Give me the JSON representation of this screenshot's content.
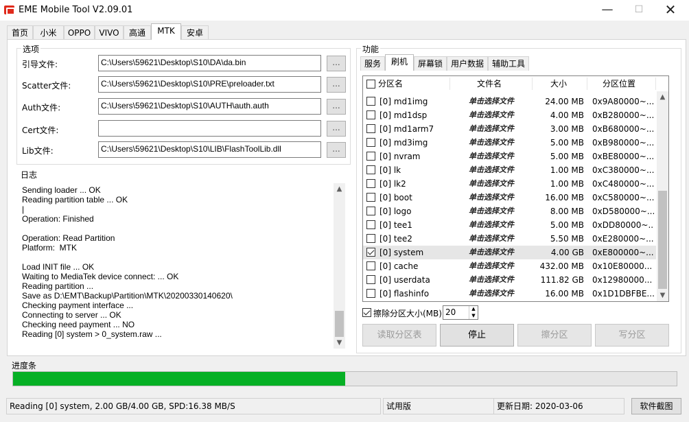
{
  "window": {
    "title": "EME Mobile Tool V2.09.01",
    "minimize": "—",
    "maximize": "☐",
    "close": "✕",
    "accent": "#06b025"
  },
  "main_tabs": [
    "首页",
    "小米",
    "OPPO",
    "VIVO",
    "高通",
    "MTK",
    "安卓"
  ],
  "active_main_tab": "MTK",
  "options": {
    "title": "选项",
    "fields": [
      {
        "label": "引导文件:",
        "value": "C:\\Users\\59621\\Desktop\\S10\\DA\\da.bin",
        "browse": "..."
      },
      {
        "label": "Scatter文件:",
        "value": "C:\\Users\\59621\\Desktop\\S10\\PRE\\preloader.txt",
        "browse": "..."
      },
      {
        "label": "Auth文件:",
        "value": "C:\\Users\\59621\\Desktop\\S10\\AUTH\\auth.auth",
        "browse": "..."
      },
      {
        "label": "Cert文件:",
        "value": "",
        "browse": "..."
      },
      {
        "label": "Lib文件:",
        "value": "C:\\Users\\59621\\Desktop\\S10\\LIB\\FlashToolLib.dll",
        "browse": "..."
      }
    ]
  },
  "log": {
    "title": "日志",
    "lines": [
      "Sending loader ... OK",
      "Reading partition table ... OK",
      "|",
      "Operation: Finished",
      "",
      "Operation: Read Partition",
      "Platform:  MTK",
      "",
      "Load INIT file ... OK",
      "Waiting to MediaTek device connect: ... OK",
      "Reading partition ...",
      "Save as D:\\EMT\\Backup\\Partition\\MTK\\20200330140620\\",
      "Checking payment interface ...",
      "Connecting to server ... OK",
      "Checking need payment ... NO",
      "Reading [0] system > 0_system.raw ..."
    ]
  },
  "functions": {
    "title": "功能",
    "tabs": [
      "服务",
      "刷机",
      "屏幕锁",
      "用户数据",
      "辅助工具"
    ],
    "active_tab": "刷机",
    "columns": [
      "分区名",
      "文件名",
      "大小",
      "分区位置"
    ],
    "rows": [
      {
        "name": "[0] md1img",
        "file": "单击选择文件",
        "size": "24.00 MB",
        "loc": "0x9A80000~...",
        "checked": false
      },
      {
        "name": "[0] md1dsp",
        "file": "单击选择文件",
        "size": "4.00 MB",
        "loc": "0xB280000~...",
        "checked": false
      },
      {
        "name": "[0] md1arm7",
        "file": "单击选择文件",
        "size": "3.00 MB",
        "loc": "0xB680000~...",
        "checked": false
      },
      {
        "name": "[0] md3img",
        "file": "单击选择文件",
        "size": "5.00 MB",
        "loc": "0xB980000~...",
        "checked": false
      },
      {
        "name": "[0] nvram",
        "file": "单击选择文件",
        "size": "5.00 MB",
        "loc": "0xBE80000~...",
        "checked": false
      },
      {
        "name": "[0] lk",
        "file": "单击选择文件",
        "size": "1.00 MB",
        "loc": "0xC380000~...",
        "checked": false
      },
      {
        "name": "[0] lk2",
        "file": "单击选择文件",
        "size": "1.00 MB",
        "loc": "0xC480000~...",
        "checked": false
      },
      {
        "name": "[0] boot",
        "file": "单击选择文件",
        "size": "16.00 MB",
        "loc": "0xC580000~...",
        "checked": false
      },
      {
        "name": "[0] logo",
        "file": "单击选择文件",
        "size": "8.00 MB",
        "loc": "0xD580000~...",
        "checked": false
      },
      {
        "name": "[0] tee1",
        "file": "单击选择文件",
        "size": "5.00 MB",
        "loc": "0xDD80000~...",
        "checked": false
      },
      {
        "name": "[0] tee2",
        "file": "单击选择文件",
        "size": "5.50 MB",
        "loc": "0xE280000~...",
        "checked": false
      },
      {
        "name": "[0] system",
        "file": "单击选择文件",
        "size": "4.00 GB",
        "loc": "0xE800000~...",
        "checked": true
      },
      {
        "name": "[0] cache",
        "file": "单击选择文件",
        "size": "432.00 MB",
        "loc": "0x10E80000...",
        "checked": false
      },
      {
        "name": "[0] userdata",
        "file": "单击选择文件",
        "size": "111.82 GB",
        "loc": "0x12980000...",
        "checked": false
      },
      {
        "name": "[0] flashinfo",
        "file": "单击选择文件",
        "size": "16.00 MB",
        "loc": "0x1D1DBFBE...",
        "checked": false
      }
    ],
    "erase_label": "擦除分区大小(MB)",
    "erase_value": "20",
    "buttons": [
      "读取分区表",
      "停止",
      "擦分区",
      "写分区"
    ]
  },
  "progress": {
    "title": "进度条",
    "fraction": 0.5
  },
  "statusbar": {
    "message": "Reading [0] system, 2.00 GB/4.00 GB, SPD:16.38 MB/S",
    "edition": "试用版",
    "updated": "更新日期:  2020-03-06",
    "screenshot_button": "软件截图"
  }
}
